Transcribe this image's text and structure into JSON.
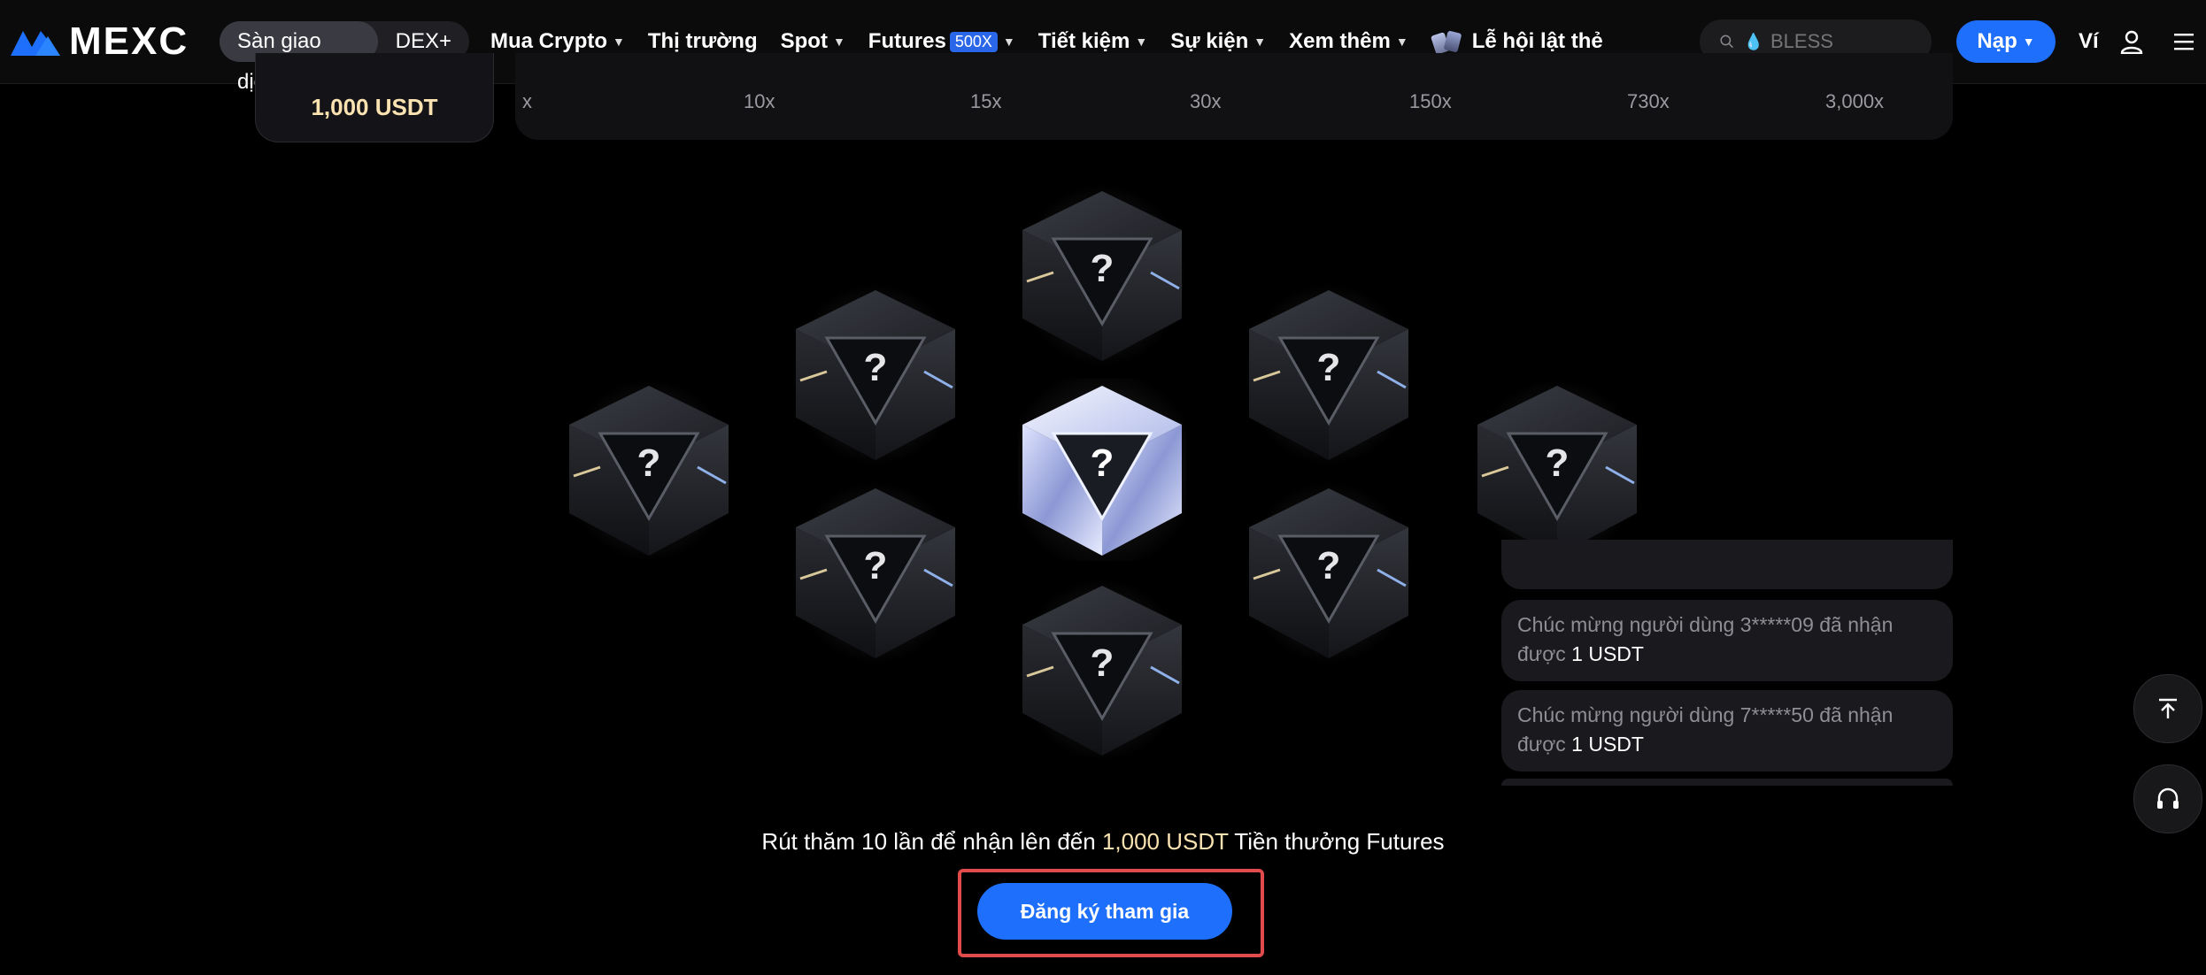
{
  "header": {
    "logo_text": "MEXC",
    "segment": [
      {
        "label": "Sàn giao dịch",
        "active": true
      },
      {
        "label": "DEX+",
        "active": false
      }
    ],
    "nav": [
      {
        "label": "Mua Crypto",
        "dropdown": true
      },
      {
        "label": "Thị trường",
        "dropdown": false
      },
      {
        "label": "Spot",
        "dropdown": true
      },
      {
        "label": "Futures",
        "badge": "500X",
        "dropdown": true
      },
      {
        "label": "Tiết kiệm",
        "dropdown": true
      },
      {
        "label": "Sự kiện",
        "dropdown": true
      },
      {
        "label": "Xem thêm",
        "dropdown": true
      },
      {
        "label": "Lễ hội lật thẻ",
        "icon": "cards-icon",
        "dropdown": false
      }
    ],
    "search_placeholder": "BLESS",
    "deposit_label": "Nạp",
    "wallet_label": "Ví"
  },
  "top_strip": {
    "prize_amount": "1,000 USDT",
    "multipliers": [
      "x",
      "10x",
      "15x",
      "30x",
      "150x",
      "730x",
      "3,000x"
    ]
  },
  "boxes": {
    "symbol": "?",
    "count": 9
  },
  "feed": [
    {
      "prefix": "Chúc mừng người dùng 3*****09 đã nhận được ",
      "amount": "1 USDT"
    },
    {
      "prefix": "Chúc mừng người dùng 7*****50 đã nhận được ",
      "amount": "1 USDT"
    }
  ],
  "cta": {
    "headline_before": "Rút thăm 10 lần để nhận lên đến ",
    "headline_highlight": "1,000 USDT",
    "headline_after": " Tiền thưởng Futures",
    "button_label": "Đăng ký tham gia"
  },
  "colors": {
    "accent_blue": "#1e6ffb",
    "gold": "#fbe3b1",
    "highlight_outline": "#e24b4b"
  }
}
